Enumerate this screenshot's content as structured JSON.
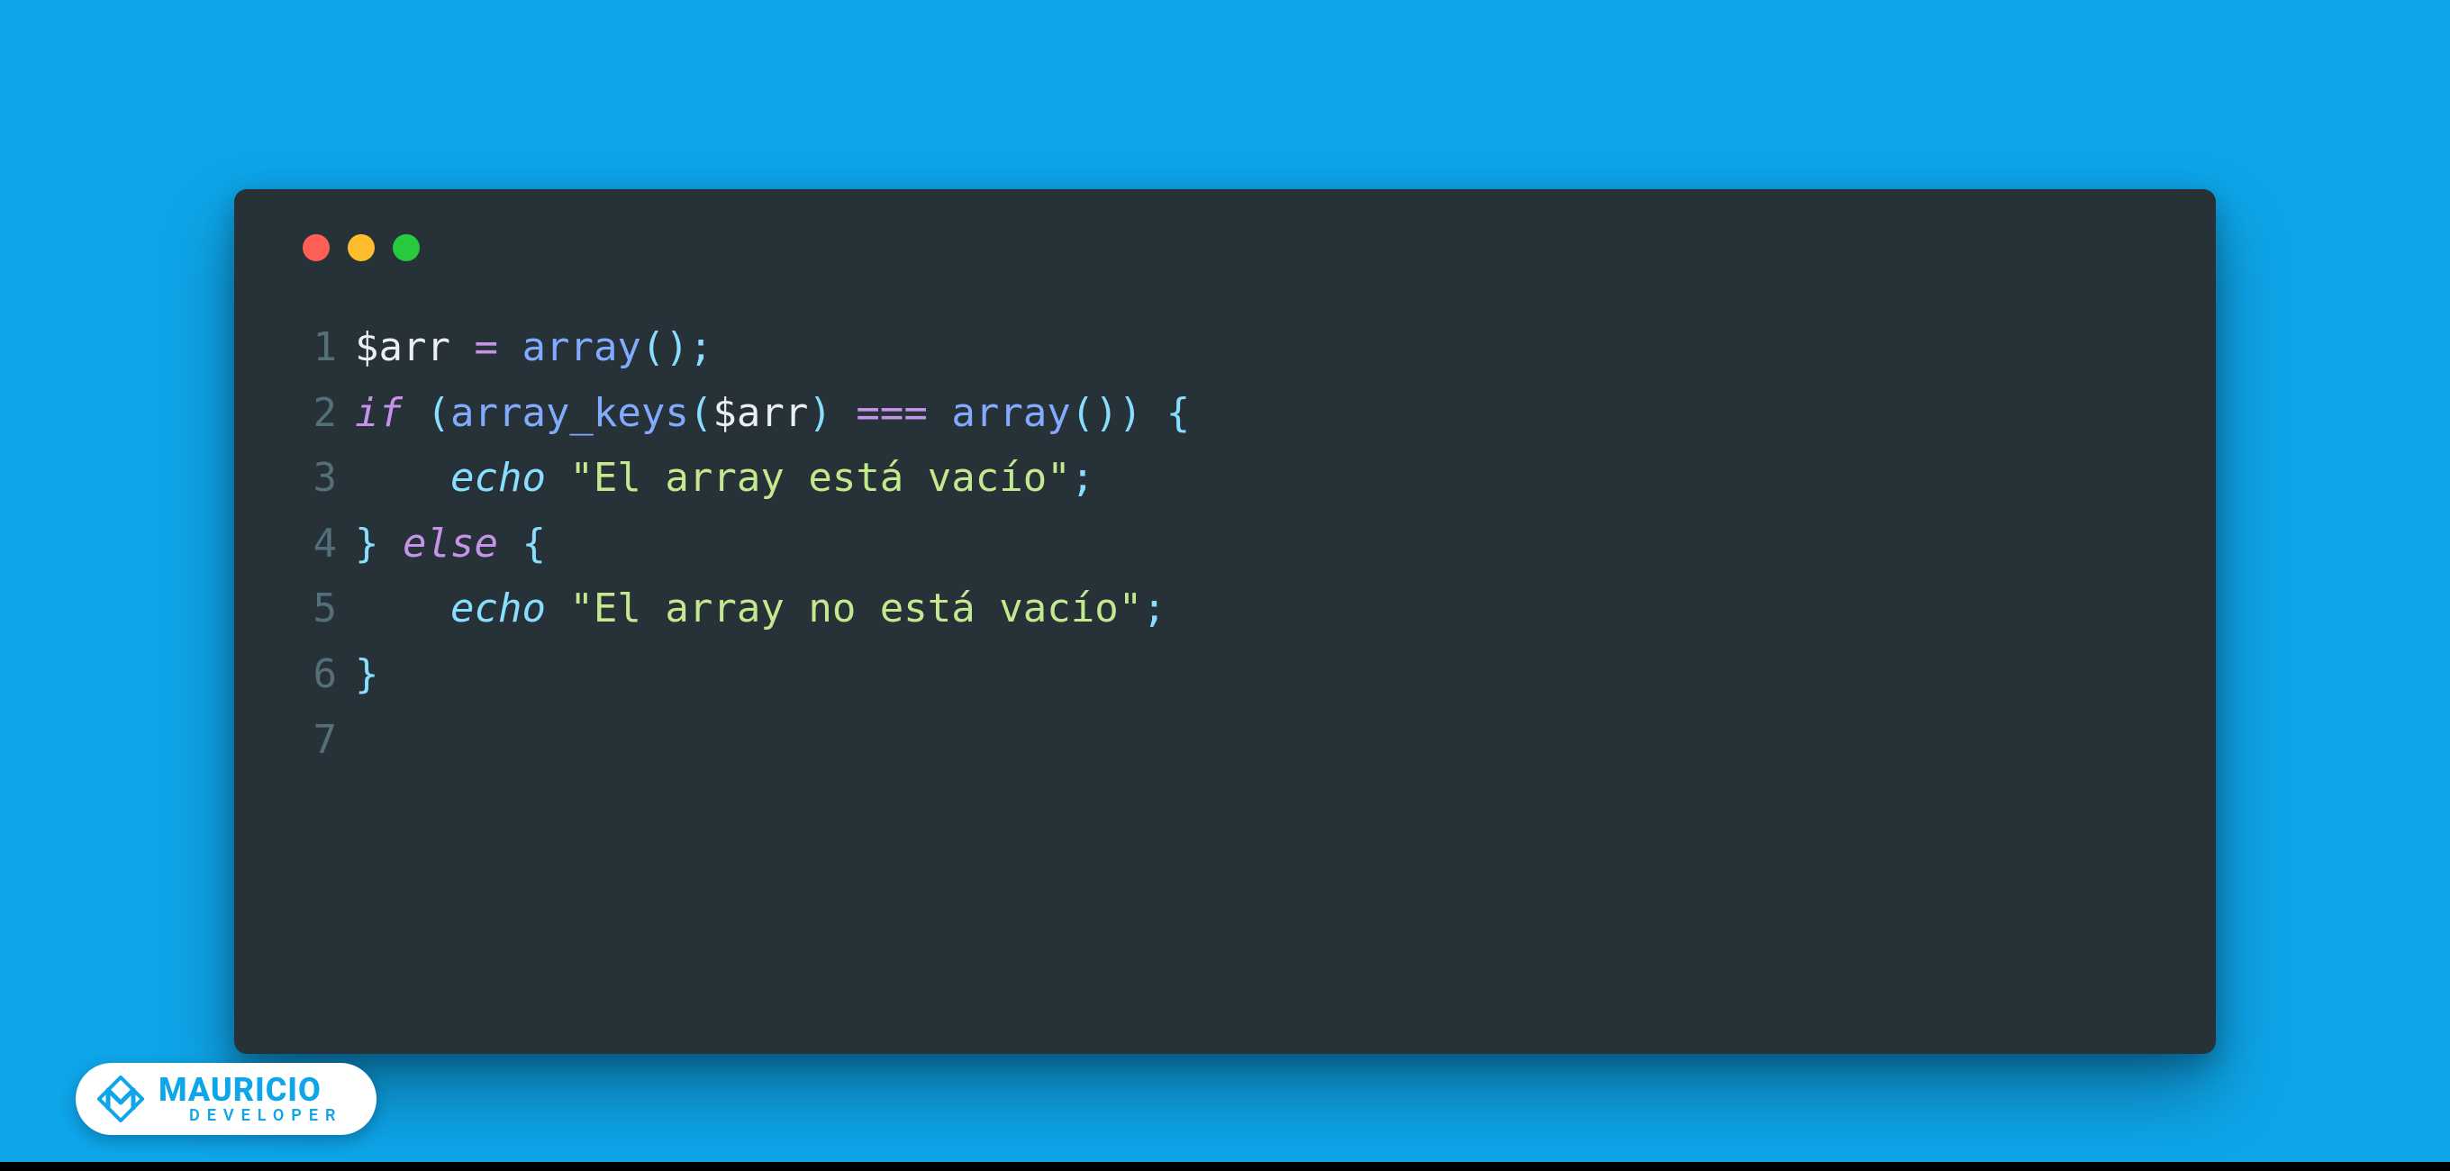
{
  "background_color": "#0ea5e9",
  "window": {
    "background": "#263238",
    "traffic_lights": [
      "red",
      "yellow",
      "green"
    ]
  },
  "code": {
    "language": "php",
    "lines": [
      {
        "n": "1",
        "tokens": [
          {
            "t": "$arr",
            "c": "var"
          },
          {
            "t": " ",
            "c": "default"
          },
          {
            "t": "=",
            "c": "op"
          },
          {
            "t": " ",
            "c": "default"
          },
          {
            "t": "array",
            "c": "func"
          },
          {
            "t": "();",
            "c": "punct"
          }
        ]
      },
      {
        "n": "2",
        "tokens": [
          {
            "t": "if",
            "c": "keyword"
          },
          {
            "t": " ",
            "c": "default"
          },
          {
            "t": "(",
            "c": "punct"
          },
          {
            "t": "array_keys",
            "c": "func"
          },
          {
            "t": "(",
            "c": "punct"
          },
          {
            "t": "$arr",
            "c": "var"
          },
          {
            "t": ")",
            "c": "punct"
          },
          {
            "t": " ",
            "c": "default"
          },
          {
            "t": "===",
            "c": "op"
          },
          {
            "t": " ",
            "c": "default"
          },
          {
            "t": "array",
            "c": "func"
          },
          {
            "t": "())",
            "c": "punct"
          },
          {
            "t": " ",
            "c": "default"
          },
          {
            "t": "{",
            "c": "punct"
          }
        ]
      },
      {
        "n": "3",
        "tokens": [
          {
            "t": "    ",
            "c": "default"
          },
          {
            "t": "echo",
            "c": "echo"
          },
          {
            "t": " ",
            "c": "default"
          },
          {
            "t": "\"El array está vacío\"",
            "c": "string"
          },
          {
            "t": ";",
            "c": "punct"
          }
        ]
      },
      {
        "n": "4",
        "tokens": [
          {
            "t": "}",
            "c": "punct"
          },
          {
            "t": " ",
            "c": "default"
          },
          {
            "t": "else",
            "c": "keyword"
          },
          {
            "t": " ",
            "c": "default"
          },
          {
            "t": "{",
            "c": "punct"
          }
        ]
      },
      {
        "n": "5",
        "tokens": [
          {
            "t": "    ",
            "c": "default"
          },
          {
            "t": "echo",
            "c": "echo"
          },
          {
            "t": " ",
            "c": "default"
          },
          {
            "t": "\"El array no está vacío\"",
            "c": "string"
          },
          {
            "t": ";",
            "c": "punct"
          }
        ]
      },
      {
        "n": "6",
        "tokens": [
          {
            "t": "}",
            "c": "punct"
          }
        ]
      },
      {
        "n": "7",
        "tokens": []
      }
    ]
  },
  "brand": {
    "name": "MAURICIO",
    "sub": "DEVELOPER",
    "color": "#0ea5e9",
    "icon": "m-lozenge-icon"
  }
}
